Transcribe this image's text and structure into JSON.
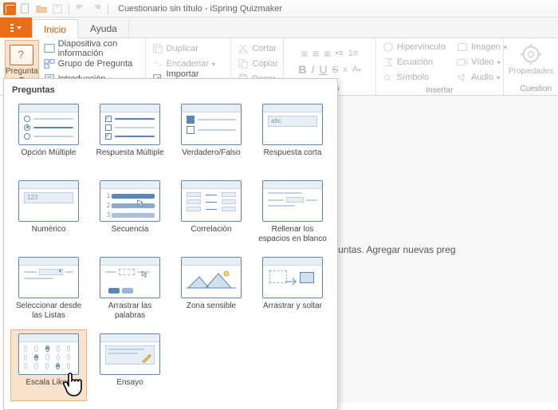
{
  "titlebar": {
    "title": "Cuestionario sin título - iSpring Quizmaker"
  },
  "tabs": {
    "file": "",
    "inicio": "Inicio",
    "ayuda": "Ayuda"
  },
  "ribbon": {
    "pregunta": "Pregunta",
    "diapositiva": "Diapositiva con información",
    "grupo": "Grupo de Pregunta",
    "introduccion": "Introducción",
    "duplicar": "Duplicar",
    "encadenar": "Encadenar",
    "importar": "Importar Preguntas",
    "cortar": "Cortar",
    "copiar": "Copiar",
    "pegar": "Pegar",
    "portapapeles": "",
    "texto": "Texto",
    "hipervinculo": "Hipervínculo",
    "ecuacion": "Ecuación",
    "simbolo": "Símbolo",
    "imagen": "Imagen",
    "video": "Vídeo",
    "audio": "Audio",
    "insertar": "Insertar",
    "propiedades": "Propiedades",
    "cuestion": "Cuestion"
  },
  "content": {
    "empty": "uestionario no tiene preguntas. Agregar nuevas preg"
  },
  "dropdown": {
    "header": "Preguntas",
    "items": [
      "Opción Múltiple",
      "Respuesta Múltiple",
      "Verdadero/Falso",
      "Respuesta corta",
      "Numérico",
      "Secuencia",
      "Correlación",
      "Rellenar los espacios en blanco",
      "Seleccionar desde las Listas",
      "Arrastrar las palabras",
      "Zona sensible",
      "Arrastrar y soltar",
      "Escala Likert",
      "Ensayo"
    ]
  }
}
